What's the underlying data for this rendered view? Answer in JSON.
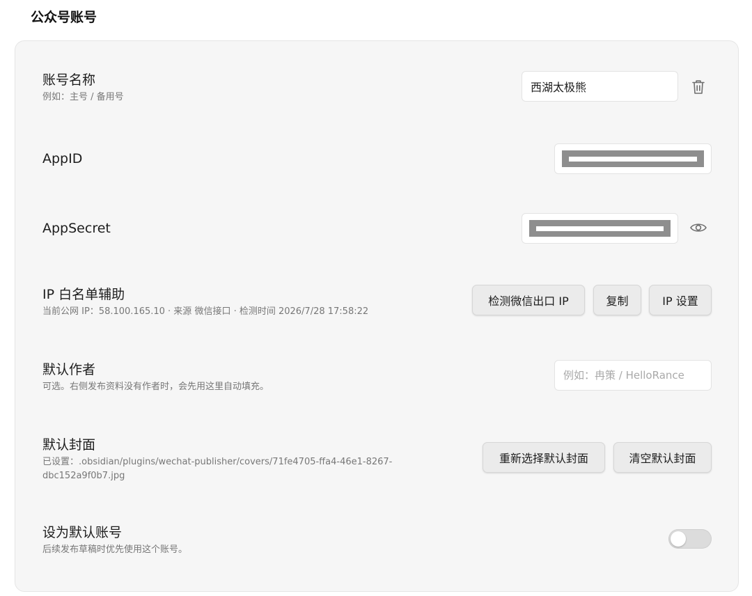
{
  "section_title": "公众号账号",
  "account_name": {
    "label": "账号名称",
    "desc": "例如：主号 / 备用号",
    "value": "西湖太极熊",
    "delete_icon": "trash-icon"
  },
  "app_id": {
    "label": "AppID"
  },
  "app_secret": {
    "label": "AppSecret",
    "reveal_icon": "eye-icon"
  },
  "ip_whitelist": {
    "label": "IP 白名单辅助",
    "desc": "当前公网 IP：58.100.165.10 · 来源 微信接口 · 检测时间 2026/7/28 17:58:22",
    "detect_button": "检测微信出口 IP",
    "copy_button": "复制",
    "settings_button": "IP 设置"
  },
  "default_author": {
    "label": "默认作者",
    "desc": "可选。右侧发布资料没有作者时，会先用这里自动填充。",
    "placeholder": "例如：冉策 / HelloRance"
  },
  "default_cover": {
    "label": "默认封面",
    "desc_line1": "已设置：.obsidian/plugins/wechat-publisher/covers/71fe4705-ffa4-46e1-8267-",
    "desc_line2": "dbc152a9f0b7.jpg",
    "reselect_button": "重新选择默认封面",
    "clear_button": "清空默认封面"
  },
  "default_account": {
    "label": "设为默认账号",
    "desc": "后续发布草稿时优先使用这个账号。",
    "enabled": false
  },
  "colors": {
    "card_background": "#f6f6f6",
    "button_background": "#ebebeb",
    "mask": "#8e8e8e",
    "toggle_off": "#dcdcdc"
  }
}
